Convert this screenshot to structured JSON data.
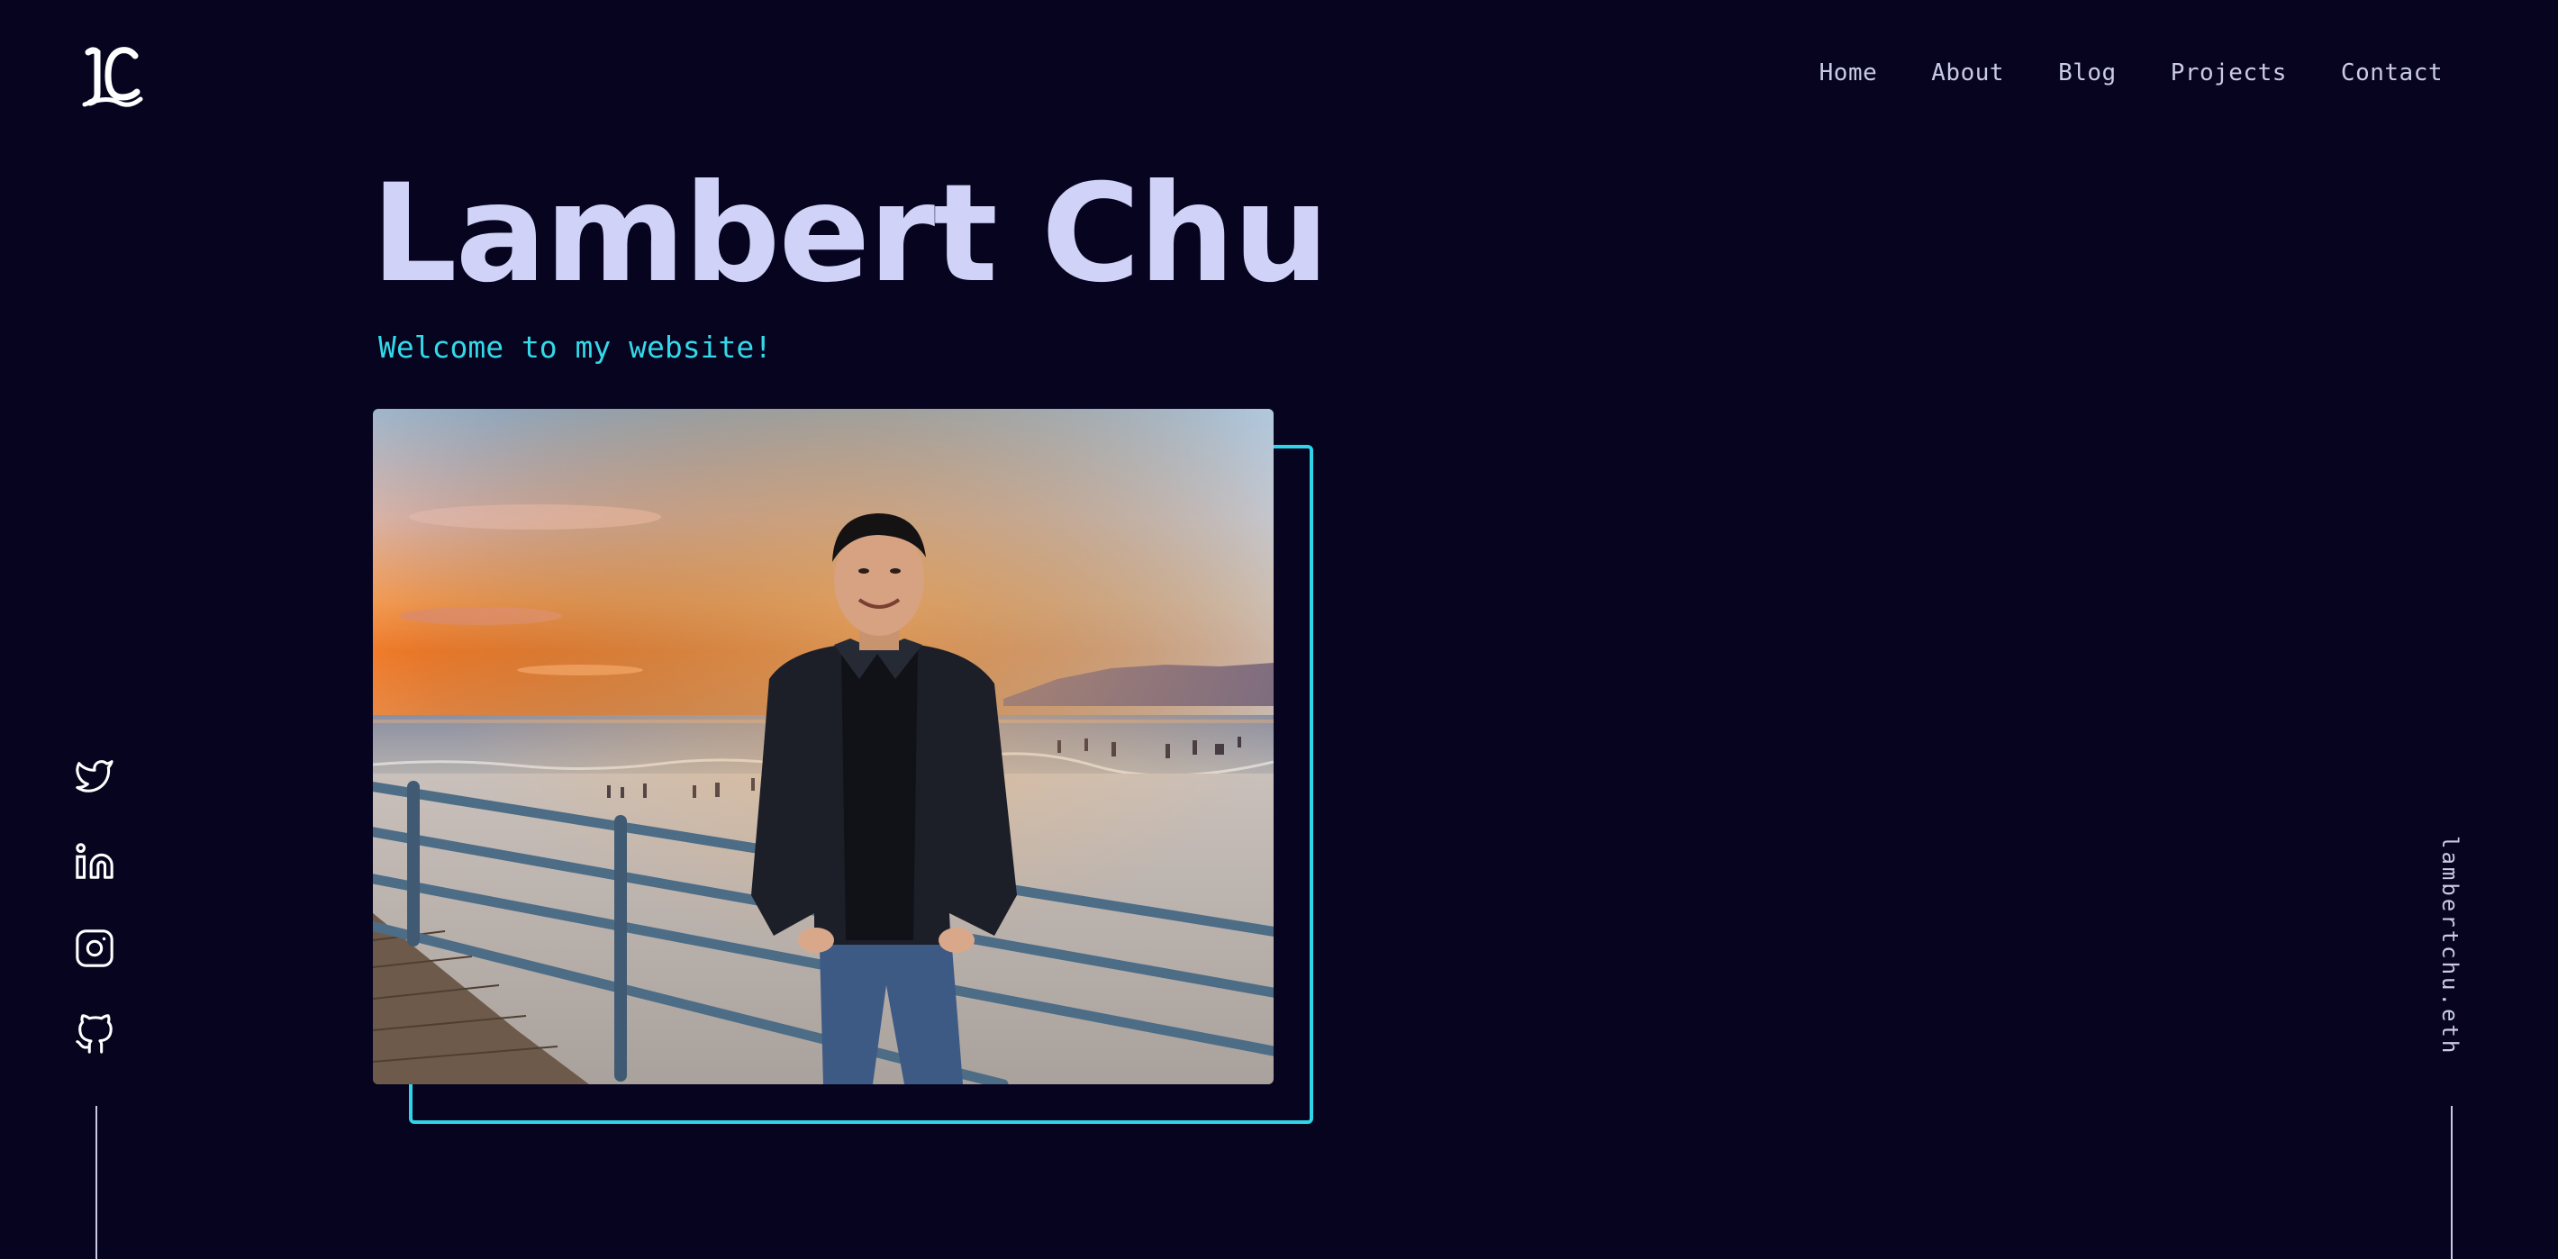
{
  "logo": {
    "text": "LC",
    "icon": "lc-monogram-logo"
  },
  "nav": {
    "items": [
      {
        "label": "Home"
      },
      {
        "label": "About"
      },
      {
        "label": "Blog"
      },
      {
        "label": "Projects"
      },
      {
        "label": "Contact"
      }
    ]
  },
  "hero": {
    "name": "Lambert Chu",
    "welcome": "Welcome to my website!"
  },
  "sidebar": {
    "socials": [
      {
        "icon": "twitter-icon"
      },
      {
        "icon": "linkedin-icon"
      },
      {
        "icon": "instagram-icon"
      },
      {
        "icon": "github-icon"
      }
    ],
    "ens": "lambertchu.eth"
  },
  "colors": {
    "background": "#070420",
    "title": "#d0d3f7",
    "accent": "#2fd4e6",
    "text": "#c9cbe6"
  }
}
